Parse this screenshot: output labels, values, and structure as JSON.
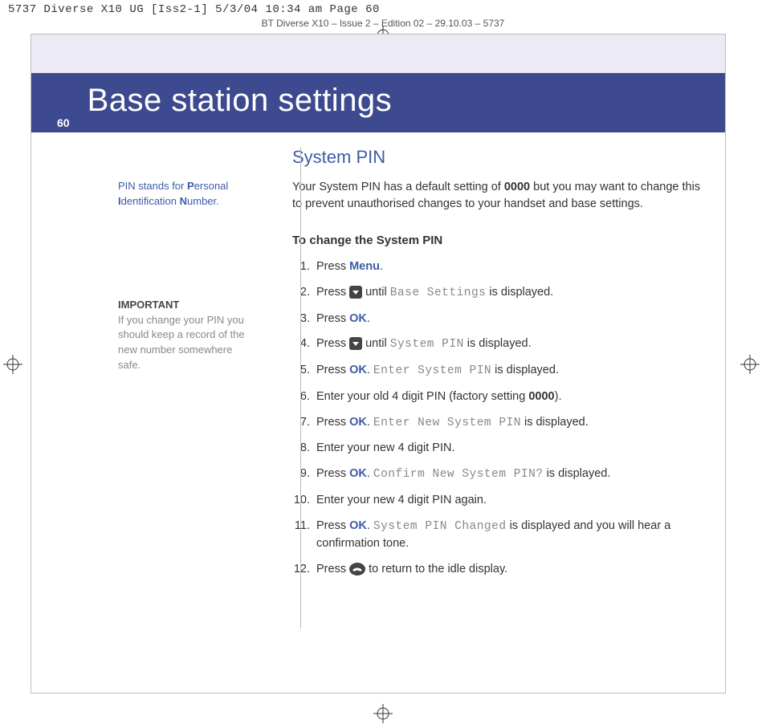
{
  "crop_mark_line": "5737 Diverse X10 UG [Iss2-1]  5/3/04  10:34 am  Page 60",
  "header_line": "BT Diverse X10 – Issue 2 – Edition 02 – 29.10.03 – 5737",
  "page_number": "60",
  "page_title": "Base station settings",
  "sidebar": {
    "pin_prefix": "PIN stands for ",
    "p": "P",
    "ersonal": "ersonal ",
    "i": "I",
    "dent": "dentification ",
    "n": "N",
    "umber": "umber.",
    "important_title": "IMPORTANT",
    "important_body": "If you change your PIN you should keep a record of the new number somewhere safe."
  },
  "main": {
    "section_heading": "System PIN",
    "intro_pre": "Your System PIN has a default setting of ",
    "intro_default": "0000",
    "intro_post": " but you may want to change this to prevent unauthorised changes to your handset and base settings.",
    "subhead": "To change the System PIN",
    "steps": {
      "s1_pre": "Press ",
      "s1_word": "Menu",
      "s1_post": ".",
      "s2_pre": "Press ",
      "s2_mid": " until ",
      "s2_lcd": "Base Settings",
      "s2_post": " is displayed.",
      "s3_pre": "Press ",
      "s3_word": "OK",
      "s3_post": ".",
      "s4_pre": "Press ",
      "s4_mid": " until ",
      "s4_lcd": "System PIN",
      "s4_post": " is displayed.",
      "s5_pre": "Press ",
      "s5_word": "OK",
      "s5_mid": ". ",
      "s5_lcd": "Enter System PIN",
      "s5_post": " is displayed.",
      "s6_pre": "Enter your old 4 digit PIN (factory setting ",
      "s6_bold": "0000",
      "s6_post": ").",
      "s7_pre": "Press ",
      "s7_word": "OK",
      "s7_mid": ". ",
      "s7_lcd": "Enter New System PIN",
      "s7_post": " is displayed.",
      "s8": "Enter your new 4 digit PIN.",
      "s9_pre": "Press ",
      "s9_word": "OK",
      "s9_mid": ". ",
      "s9_lcd": "Confirm New System PIN?",
      "s9_post": " is displayed.",
      "s10": "Enter your new 4 digit PIN again.",
      "s11_pre": "Press ",
      "s11_word": "OK",
      "s11_mid": ". ",
      "s11_lcd": "System PIN Changed",
      "s11_post": " is displayed and you will hear a confirmation tone.",
      "s12_pre": "Press ",
      "s12_post": " to return to the idle display."
    }
  }
}
